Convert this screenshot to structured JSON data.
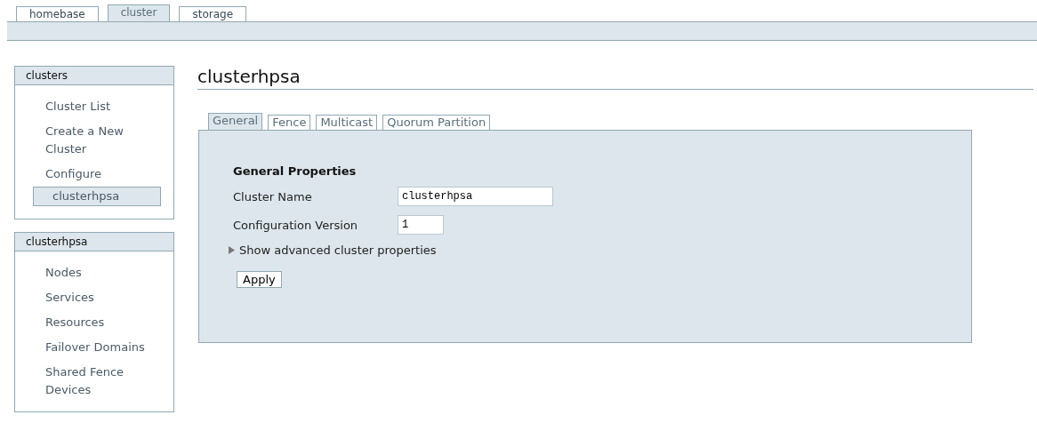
{
  "top_tabs": [
    {
      "label": "homebase",
      "selected": false
    },
    {
      "label": "cluster",
      "selected": true
    },
    {
      "label": "storage",
      "selected": false
    }
  ],
  "sidebar": [
    {
      "title": "clusters",
      "items": [
        {
          "label": "Cluster List",
          "selected": false
        },
        {
          "label": "Create a New Cluster",
          "selected": false
        },
        {
          "label": "Configure",
          "selected": false
        },
        {
          "label": "clusterhpsa",
          "selected": true
        }
      ]
    },
    {
      "title": "clusterhpsa",
      "items": [
        {
          "label": "Nodes",
          "selected": false
        },
        {
          "label": "Services",
          "selected": false
        },
        {
          "label": "Resources",
          "selected": false
        },
        {
          "label": "Failover Domains",
          "selected": false
        },
        {
          "label": "Shared Fence Devices",
          "selected": false
        }
      ]
    }
  ],
  "page_title": "clusterhpsa",
  "tabs": [
    {
      "label": "General",
      "selected": true
    },
    {
      "label": "Fence",
      "selected": false
    },
    {
      "label": "Multicast",
      "selected": false
    },
    {
      "label": "Quorum Partition",
      "selected": false
    }
  ],
  "section_title": "General Properties",
  "fields": [
    {
      "label": "Cluster Name",
      "value": "clusterhpsa",
      "kind": "wide"
    },
    {
      "label": "Configuration Version",
      "value": "1",
      "kind": "narrow"
    }
  ],
  "advanced": {
    "label": "Show advanced cluster properties",
    "expanded": false
  },
  "apply_button": "Apply"
}
